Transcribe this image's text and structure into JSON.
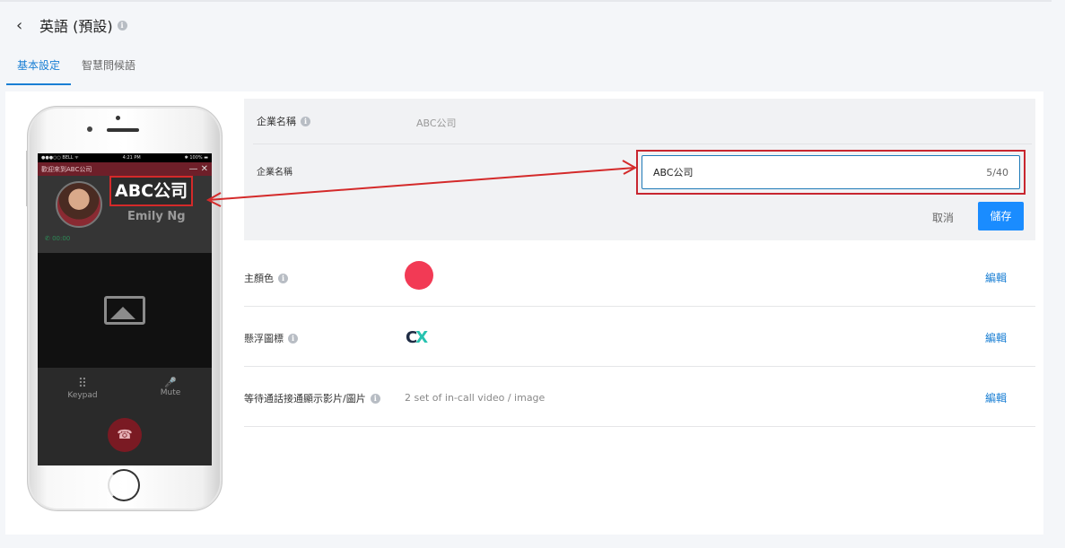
{
  "header": {
    "back": "‹",
    "title": "英語 (預設)",
    "info": "i"
  },
  "tabs": [
    {
      "label": "基本設定",
      "active": true
    },
    {
      "label": "智慧問候語",
      "active": false
    }
  ],
  "phone_preview": {
    "status_left": "●●●○○ BELL ᯤ",
    "status_time": "4:21 PM",
    "status_right": "✱ 100% ▬",
    "call_banner": "歡迎來到ABC公司",
    "banner_controls": "— ✕",
    "company_name": "ABC公司",
    "contact_name": "Emily Ng",
    "timer": "✆ 00:00",
    "keypad_icon": "⠿",
    "keypad_label": "Keypad",
    "mute_icon": "🎤",
    "mute_label": "Mute",
    "hangup_icon": "☎"
  },
  "company_name_row": {
    "label": "企業名稱",
    "value": "ABC公司",
    "edit_label": "企業名稱",
    "input_value": "ABC公司",
    "char_count": "5/40",
    "cancel": "取消",
    "save": "儲存"
  },
  "settings": [
    {
      "label": "主顏色",
      "edit": "編輯",
      "color": "#f23a55"
    },
    {
      "label": "懸浮圖標",
      "edit": "編輯",
      "logo_c": "C",
      "logo_x": "X"
    },
    {
      "label": "等待通話接通顯示影片/圖片",
      "edit": "編輯",
      "value": "2 set of in-call video / image"
    }
  ],
  "colors": {
    "accent": "#1a7fd4",
    "primary_button": "#1a8cff",
    "highlight": "#c8262f"
  }
}
